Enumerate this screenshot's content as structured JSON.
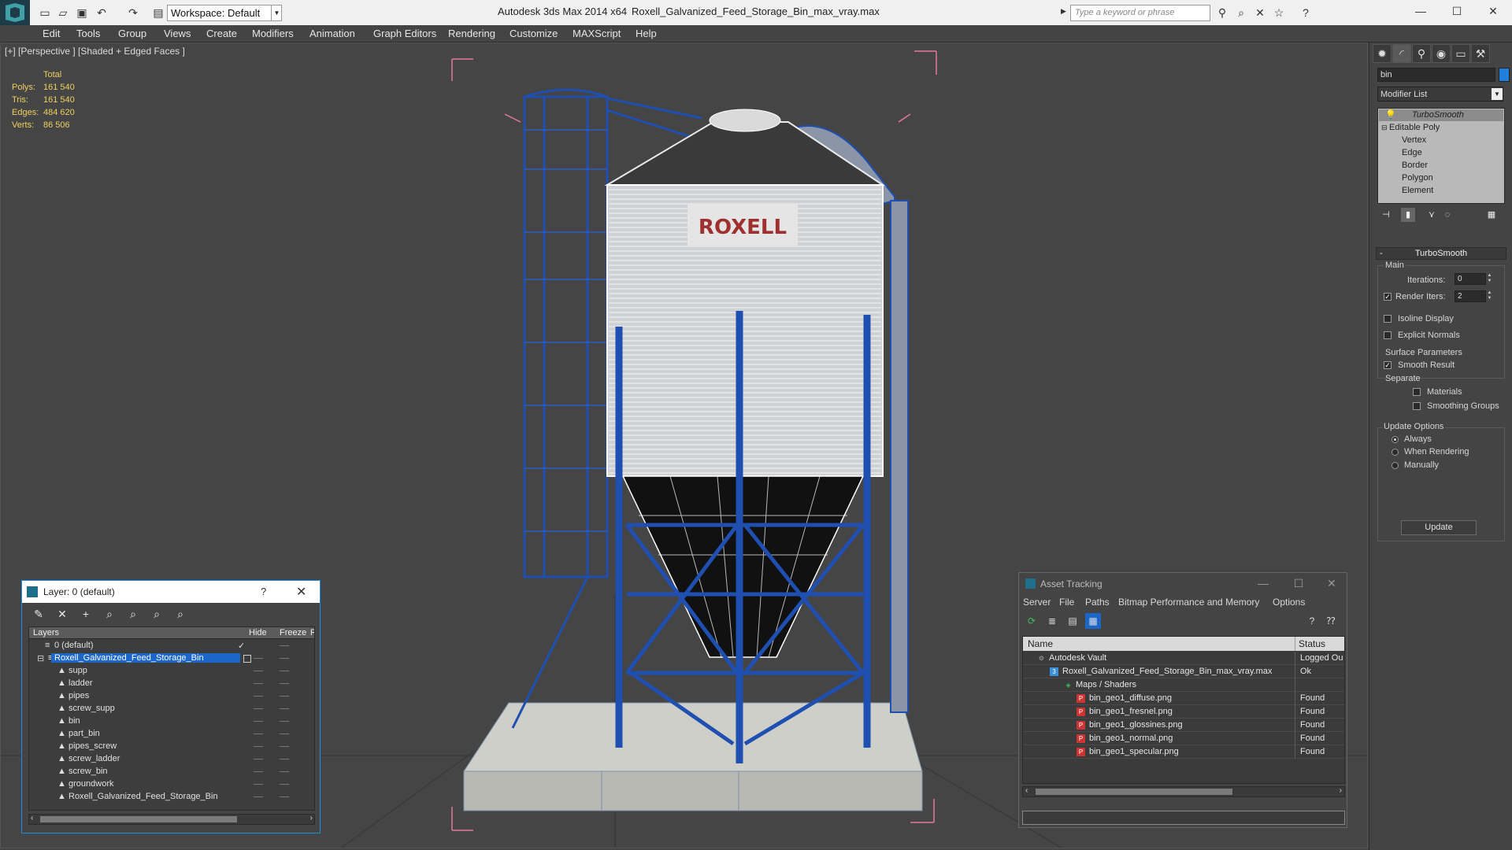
{
  "titlebar": {
    "workspace": "Workspace: Default",
    "app_title": "Autodesk 3ds Max  2014 x64",
    "file_title": "Roxell_Galvanized_Feed_Storage_Bin_max_vray.max",
    "search_placeholder": "Type a keyword or phrase"
  },
  "menu": [
    "Edit",
    "Tools",
    "Group",
    "Views",
    "Create",
    "Modifiers",
    "Animation",
    "Graph Editors",
    "Rendering",
    "Customize",
    "MAXScript",
    "Help"
  ],
  "viewport": {
    "label": "[+] [Perspective ] [Shaded + Edged Faces ]",
    "stats_header": "Total",
    "stats": [
      {
        "key": "Polys:",
        "value": "161 540"
      },
      {
        "key": "Tris:",
        "value": "161 540"
      },
      {
        "key": "Edges:",
        "value": "484 620"
      },
      {
        "key": "Verts:",
        "value": "86 506"
      }
    ],
    "bin_logo": "ROXELL"
  },
  "command_panel": {
    "object_name": "bin",
    "object_color": "#1f7fd9",
    "modifier_list": "Modifier List",
    "stack": [
      "TurboSmooth",
      "Editable Poly",
      "Vertex",
      "Edge",
      "Border",
      "Polygon",
      "Element"
    ],
    "rollout_title": "TurboSmooth",
    "main_label": "Main",
    "iterations_label": "Iterations:",
    "iterations_value": "0",
    "render_iters_label": "Render Iters:",
    "render_iters_value": "2",
    "isoline_label": "Isoline Display",
    "explicit_normals_label": "Explicit Normals",
    "surface_params_label": "Surface Parameters",
    "smooth_result_label": "Smooth Result",
    "separate_label": "Separate",
    "materials_label": "Materials",
    "smoothing_groups_label": "Smoothing Groups",
    "update_options_label": "Update Options",
    "always_label": "Always",
    "when_rendering_label": "When Rendering",
    "manually_label": "Manually",
    "update_button": "Update"
  },
  "layer_dialog": {
    "title": "Layer: 0 (default)",
    "help": "?",
    "col_layers": "Layers",
    "col_hide": "Hide",
    "col_freeze": "Freeze",
    "col_extra": "R",
    "rows": [
      "0 (default)",
      "Roxell_Galvanized_Feed_Storage_Bin",
      "supp",
      "ladder",
      "pipes",
      "screw_supp",
      "bin",
      "part_bin",
      "pipes_screw",
      "screw_ladder",
      "screw_bin",
      "groundwork",
      "Roxell_Galvanized_Feed_Storage_Bin"
    ]
  },
  "asset_dialog": {
    "title": "Asset Tracking",
    "menu": [
      "Server",
      "File",
      "Paths",
      "Bitmap Performance and Memory",
      "Options"
    ],
    "col_name": "Name",
    "col_status": "Status",
    "rows": [
      {
        "name": "Autodesk Vault",
        "status": "Logged Ou"
      },
      {
        "name": "Roxell_Galvanized_Feed_Storage_Bin_max_vray.max",
        "status": "Ok"
      },
      {
        "name": "Maps / Shaders",
        "status": ""
      },
      {
        "name": "bin_geo1_diffuse.png",
        "status": "Found"
      },
      {
        "name": "bin_geo1_fresnel.png",
        "status": "Found"
      },
      {
        "name": "bin_geo1_glossines.png",
        "status": "Found"
      },
      {
        "name": "bin_geo1_normal.png",
        "status": "Found"
      },
      {
        "name": "bin_geo1_specular.png",
        "status": "Found"
      }
    ]
  }
}
